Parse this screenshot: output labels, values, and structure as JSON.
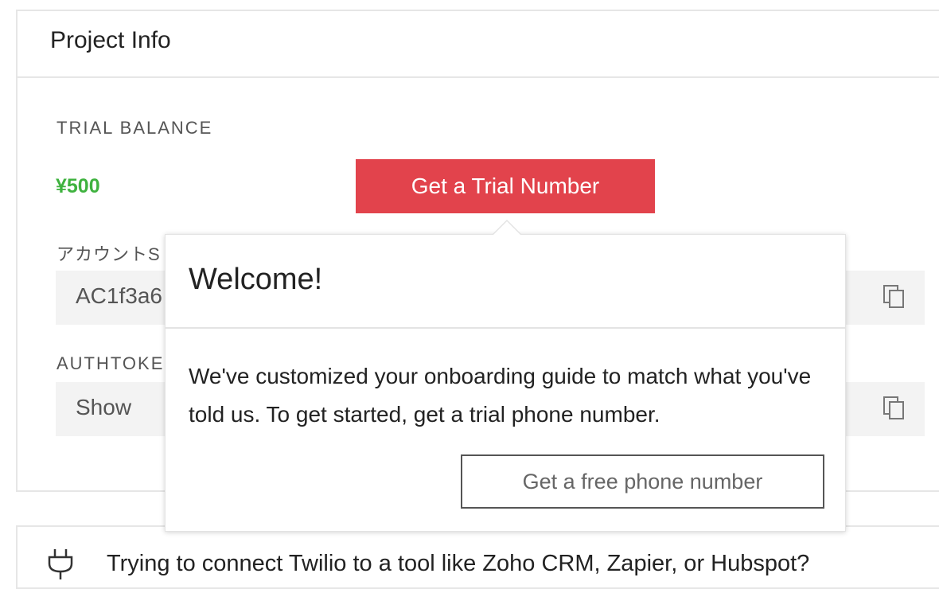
{
  "project_info": {
    "title": "Project Info",
    "trial_balance_label": "TRIAL BALANCE",
    "trial_balance_value": "¥500",
    "get_trial_number_label": "Get a Trial Number",
    "account_sid_label": "アカウントS",
    "account_sid_value": "AC1f3a6",
    "authtoken_label": "AUTHTOKE",
    "authtoken_value": "Show"
  },
  "popover": {
    "title": "Welcome!",
    "body": "We've customized your onboarding guide to match what you've told us. To get started, get a trial phone number.",
    "button_label": "Get a free phone number"
  },
  "banner": {
    "text": "Trying to connect Twilio to a tool like Zoho CRM, Zapier, or Hubspot?"
  },
  "colors": {
    "accent_red": "#e2434c",
    "balance_green": "#3fb23f"
  },
  "icons": {
    "copy": "copy-icon",
    "plug": "plug-icon"
  }
}
